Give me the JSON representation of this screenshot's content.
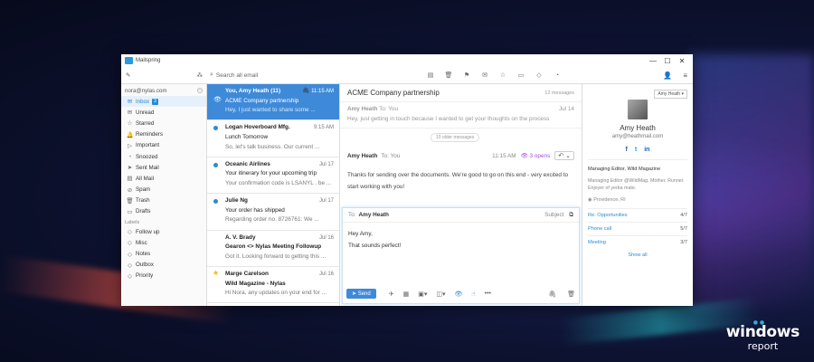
{
  "window": {
    "app_name": "Mailspring",
    "min": "—",
    "max": "☐",
    "close": "✕"
  },
  "toolbar": {
    "search_placeholder": "Search all email"
  },
  "sidebar": {
    "account": "nora@nylas.com",
    "items": [
      {
        "label": "Inbox",
        "icon": "✉",
        "badge": "3",
        "active": true
      },
      {
        "label": "Unread",
        "icon": "✉",
        "badge": ""
      },
      {
        "label": "Starred",
        "icon": "☆",
        "badge": ""
      },
      {
        "label": "Reminders",
        "icon": "🔔",
        "badge": ""
      },
      {
        "label": "Important",
        "icon": "▷",
        "badge": ""
      },
      {
        "label": "Snoozed",
        "icon": "◔",
        "badge": ""
      },
      {
        "label": "Sent Mail",
        "icon": "➤",
        "badge": ""
      },
      {
        "label": "All Mail",
        "icon": "▤",
        "badge": ""
      },
      {
        "label": "Spam",
        "icon": "⊘",
        "badge": ""
      },
      {
        "label": "Trash",
        "icon": "🗑",
        "badge": ""
      },
      {
        "label": "Drafts",
        "icon": "▭",
        "badge": ""
      }
    ],
    "labels_header": "Labels",
    "labels": [
      {
        "label": "Follow up",
        "icon": "◇"
      },
      {
        "label": "Misc",
        "icon": "◇"
      },
      {
        "label": "Notes",
        "icon": "◇"
      },
      {
        "label": "Outbox",
        "icon": "◇"
      },
      {
        "label": "Priority",
        "icon": "◇"
      }
    ]
  },
  "messages": [
    {
      "from": "You, Amy Heath (11)",
      "date": "11:15 AM",
      "subject": "ACME Company partnership",
      "snippet": "Hey, I just wanted to share some ...",
      "selected": true
    },
    {
      "from": "Logan Hoverboard Mfg.",
      "date": "9:15 AM",
      "subject": "Lunch Tomorrow",
      "snippet": "So, let's talk business. Our current ...",
      "unread": true
    },
    {
      "from": "Oceanic Airlines",
      "date": "Jul 17",
      "subject": "Your itinerary for your upcoming trip",
      "snippet": "Your confirmation code is LSANYL . be ...",
      "unread": true
    },
    {
      "from": "Julie Ng",
      "date": "Jul 17",
      "subject": "Your order has shipped",
      "snippet": "Regarding order no. 8726761: We ...",
      "unread": true
    },
    {
      "from": "A. V. Brady",
      "date": "Jul 16",
      "subject": "Gearon <> Nylas Meeting Followup",
      "snippet": "Got it. Looking forward to getting this ..."
    },
    {
      "from": "Marge Carelson",
      "date": "Jul 16",
      "subject": "Wild Magazine - Nylas",
      "snippet": "Hi Nora, any updates on your end for ...",
      "starred": true
    }
  ],
  "reader": {
    "subject": "ACME Company partnership",
    "count": "12 messages",
    "older_label": "10 older messages",
    "first": {
      "from": "Amy Heath",
      "to": "To: You",
      "date": "Jul 14",
      "preview": "Hey, just getting in touch because I wanted to get your thoughts on the process"
    },
    "second": {
      "from": "Amy Heath",
      "to": "To: You",
      "time": "11:15 AM",
      "opens": "3 opens",
      "body": "Thanks for sending over the documents. We're good to go on this end - very excited to start working with you!"
    }
  },
  "compose": {
    "to_label": "To:",
    "to_name": "Amy Heath",
    "subject_label": "Subject",
    "line1": "Hey Amy,",
    "line2": "That sounds perfect!",
    "send_label": "Send"
  },
  "contact": {
    "selector": "Amy Heath",
    "name": "Amy Heath",
    "email": "amy@heathmail.com",
    "social": {
      "facebook": "f",
      "twitter": "t",
      "linkedin": "in"
    },
    "title": "Managing Editor, Wild Magazine",
    "bio": "Managing Editor @WildMag. Mother. Runner. Enjoyer of yerba mate.",
    "location": "Providence, RI",
    "related": [
      {
        "name": "Re: Opportunities",
        "count": "4/7"
      },
      {
        "name": "Phone call",
        "count": "5/7"
      },
      {
        "name": "Meeting",
        "count": "3/7"
      }
    ],
    "show_all": "Show all"
  },
  "watermark": {
    "line1": "windows",
    "line2": "report"
  }
}
